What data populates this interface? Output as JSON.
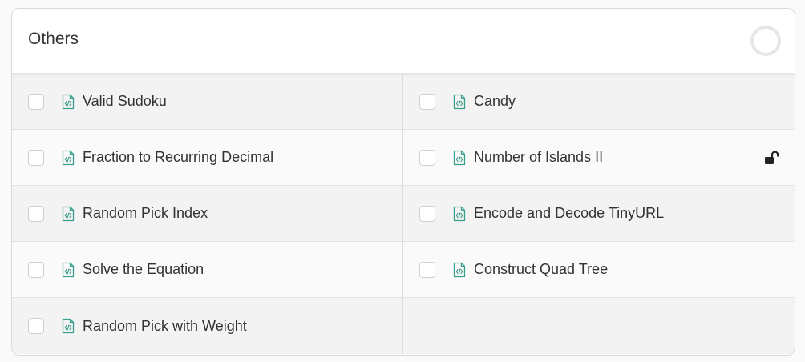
{
  "section": {
    "title": "Others"
  },
  "colors": {
    "file_icon": "#3a9e8d",
    "lock_icon": "#222222",
    "ring": "#e6e6e6"
  },
  "problems": [
    {
      "label": "Valid Sudoku",
      "icon": "file-code-icon"
    },
    {
      "label": "Candy",
      "icon": "file-code-icon"
    },
    {
      "label": "Fraction to Recurring Decimal",
      "icon": "file-code-icon"
    },
    {
      "label": "Number of Islands II",
      "icon": "file-code-icon",
      "status_icon": "unlock-icon"
    },
    {
      "label": "Random Pick Index",
      "icon": "file-code-icon"
    },
    {
      "label": "Encode and Decode TinyURL",
      "icon": "file-code-icon"
    },
    {
      "label": "Solve the Equation",
      "icon": "file-code-icon"
    },
    {
      "label": "Construct Quad Tree",
      "icon": "file-code-icon"
    },
    {
      "label": "Random Pick with Weight",
      "icon": "file-code-icon"
    }
  ]
}
